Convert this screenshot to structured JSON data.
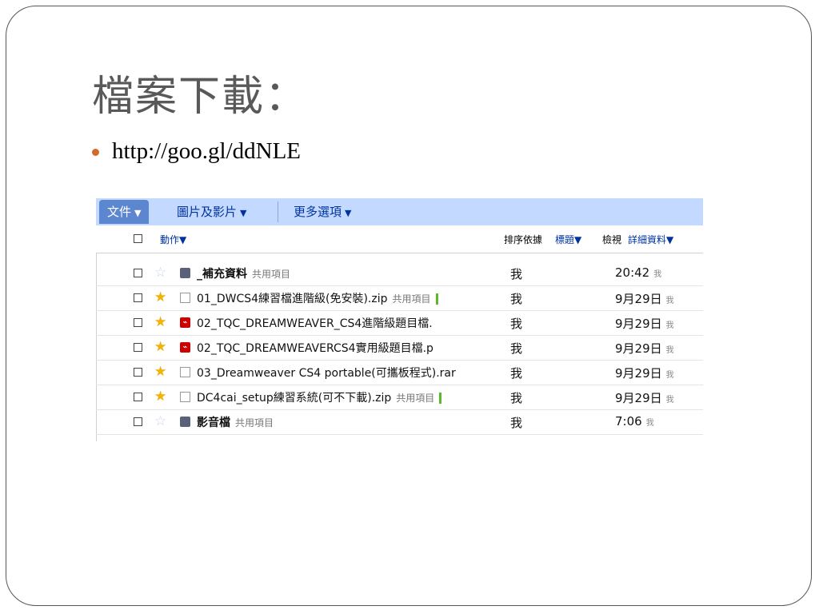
{
  "slide": {
    "title": "檔案下載：",
    "bullet_link": "http://goo.gl/ddNLE"
  },
  "toolbar": {
    "docs_label": "文件",
    "images_label": "圖片及影片",
    "more_label": "更多選項",
    "arrow": "▼"
  },
  "list_header": {
    "actions_label": "動作▼",
    "sort_by_label": "排序依據",
    "sort_value": "標題▼",
    "view_label": "檢視",
    "view_value": "詳細資料▼"
  },
  "rows": [
    {
      "starred": false,
      "type": "folder",
      "name": "_補充資料",
      "shared": "共用項目",
      "green": false,
      "owner": "我",
      "date": "20:42",
      "by": "我"
    },
    {
      "starred": true,
      "type": "doc",
      "name": "01_DWCS4練習檔進階級(免安裝).zip",
      "shared": "共用項目",
      "green": true,
      "owner": "我",
      "date": "9月29日",
      "by": "我"
    },
    {
      "starred": true,
      "type": "pdf",
      "name": "02_TQC_DREAMWEAVER_CS4進階級題目檔.",
      "shared": "",
      "green": false,
      "owner": "我",
      "date": "9月29日",
      "by": "我"
    },
    {
      "starred": true,
      "type": "pdf",
      "name": "02_TQC_DREAMWEAVERCS4實用級題目檔.p",
      "shared": "",
      "green": false,
      "owner": "我",
      "date": "9月29日",
      "by": "我"
    },
    {
      "starred": true,
      "type": "doc",
      "name": "03_Dreamweaver CS4 portable(可攜板程式).rar",
      "shared": "",
      "green": false,
      "owner": "我",
      "date": "9月29日",
      "by": "我"
    },
    {
      "starred": true,
      "type": "doc",
      "name": "DC4cai_setup練習系統(可不下載).zip",
      "shared": "共用項目",
      "green": true,
      "owner": "我",
      "date": "9月29日",
      "by": "我"
    },
    {
      "starred": false,
      "type": "folder",
      "name": "影音檔",
      "shared": "共用項目",
      "green": false,
      "owner": "我",
      "date": "7:06",
      "by": "我"
    }
  ],
  "colors": {
    "accent": "#c3d9ff",
    "active_tab": "#5d86d0",
    "bullet": "#d46a2a",
    "star": "#f2b400",
    "pdf": "#cc0000"
  }
}
